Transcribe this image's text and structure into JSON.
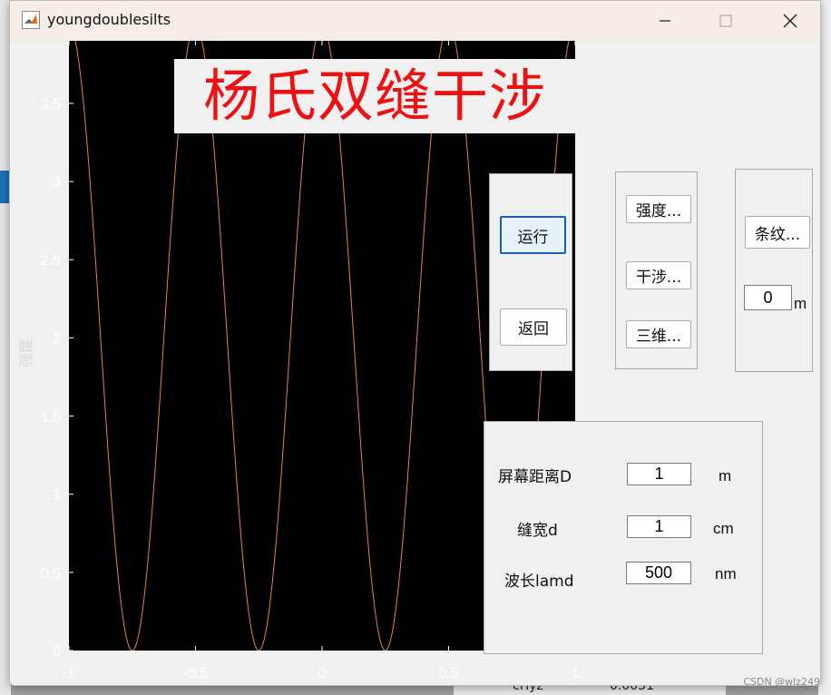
{
  "window": {
    "title": "youngdoublesilts"
  },
  "banner": {
    "text": "杨氏双缝干涉"
  },
  "plot": {
    "ylabel": "强度",
    "accent_color": "#e8843a",
    "background": "#000000"
  },
  "chart_data": {
    "type": "line",
    "title": "",
    "xlabel": "",
    "ylabel": "强度",
    "xlim": [
      -1,
      1
    ],
    "ylim": [
      0,
      3.9
    ],
    "xticks": [
      "-1",
      "-0.5",
      "0",
      "0.5",
      "1"
    ],
    "yticks": [
      "0",
      "0.5",
      "1",
      "1.5",
      "2",
      "2.5",
      "3",
      "3.5"
    ],
    "series": [
      {
        "function": "4*cos^2(2*pi*x)",
        "amplitude": 4,
        "period": 0.5,
        "minima_x": [
          -0.75,
          -0.25,
          0.25,
          0.75
        ],
        "color": "#e8843a"
      }
    ]
  },
  "controls": {
    "run_label": "运行",
    "back_label": "返回",
    "intensity_label": "强度...",
    "interference_label": "干涉...",
    "threed_label": "三维...",
    "fringe_label": "条纹...",
    "fringe_value": "0",
    "fringe_unit": "m"
  },
  "params": {
    "distance_label": "屏幕距离D",
    "distance_value": "1",
    "distance_unit": "m",
    "slit_label": "缝宽d",
    "slit_value": "1",
    "slit_unit": "cm",
    "wavelength_label": "波长lamd",
    "wavelength_value": "500",
    "wavelength_unit": "nm"
  },
  "background": {
    "watermark": "CSDN @wlz249",
    "bottom_text_1": "cHyz",
    "bottom_text_2": "0.0031"
  }
}
